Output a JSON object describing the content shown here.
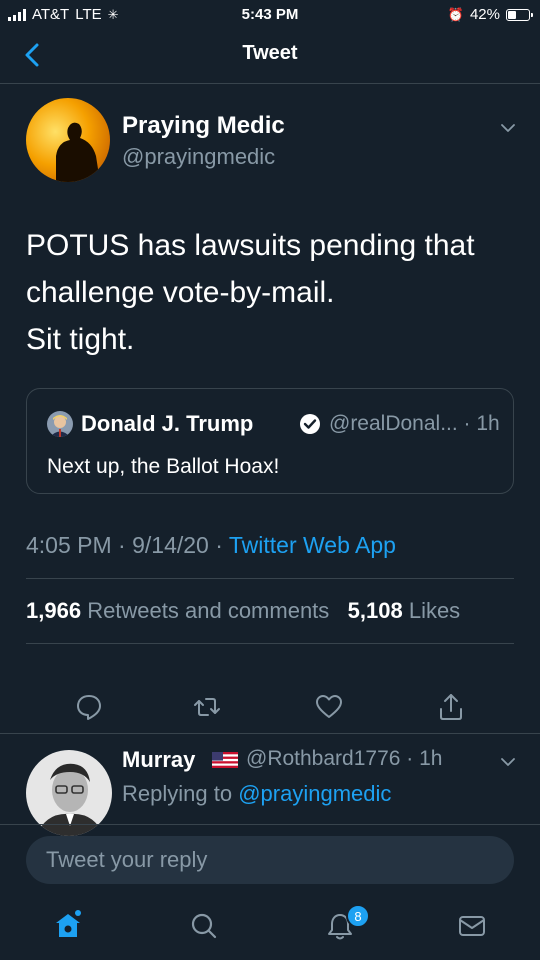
{
  "status_bar": {
    "carrier": "AT&T",
    "network": "LTE",
    "time": "5:43 PM",
    "battery": "42%",
    "battery_level": 0.42
  },
  "header": {
    "title": "Tweet",
    "back_icon": "chevron-left-icon"
  },
  "tweet": {
    "author_name": "Praying Medic",
    "author_handle": "@prayingmedic",
    "text_lines": [
      "POTUS has lawsuits pending that",
      "challenge vote-by-mail.",
      "Sit tight."
    ],
    "quote": {
      "name": "Donald J. Trump",
      "handle_time": "@realDonal... · 1h",
      "text": "Next up, the Ballot Hoax!"
    },
    "time": "4:05 PM",
    "date": "9/14/20",
    "source": "Twitter Web App",
    "retweets_count": "1,966",
    "retweets_label": "Retweets and comments",
    "likes_count": "5,108",
    "likes_label": "Likes"
  },
  "actions": [
    "reply-icon",
    "retweet-icon",
    "like-icon",
    "share-icon"
  ],
  "reply": {
    "author_name": "Murray",
    "flag": "us-flag-icon",
    "handle_time": "@Rothbard1776 · 1h",
    "replying_to_label": "Replying to",
    "replying_to_handle": "@prayingmedic"
  },
  "compose": {
    "placeholder": "Tweet your reply"
  },
  "tabbar": {
    "items": [
      "home-icon",
      "search-icon",
      "notifications-icon",
      "messages-icon"
    ],
    "notifications_badge": "8"
  },
  "colors": {
    "background": "#15202b",
    "accent": "#1da1f2",
    "muted": "#8899a6",
    "divider": "#38444d"
  }
}
